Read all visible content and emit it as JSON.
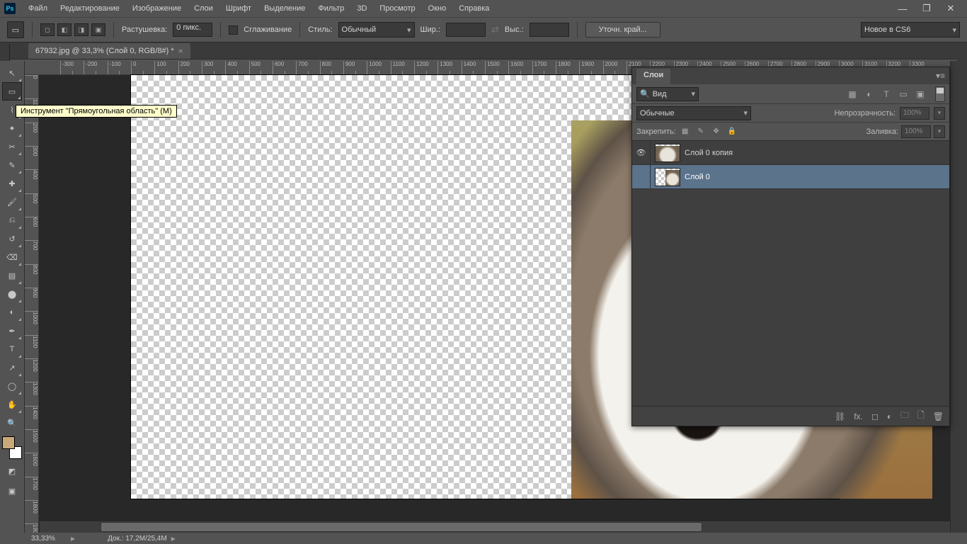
{
  "menu": [
    "Файл",
    "Редактирование",
    "Изображение",
    "Слои",
    "Шрифт",
    "Выделение",
    "Фильтр",
    "3D",
    "Просмотр",
    "Окно",
    "Справка"
  ],
  "options": {
    "feather_label": "Растушевка:",
    "feather_value": "0 пикс.",
    "antialias_label": "Сглаживание",
    "style_label": "Стиль:",
    "style_value": "Обычный",
    "width_label": "Шир.:",
    "width_value": "",
    "height_label": "Выс.:",
    "height_value": "",
    "refine_btn": "Уточн. край...",
    "whats_new": "Новое в CS6"
  },
  "doc_tab": "67932.jpg @ 33,3% (Слой 0, RGB/8#) *",
  "tooltip": "Инструмент \"Прямоугольная область\" (M)",
  "tools": [
    {
      "id": "move-tool",
      "glyph": "↖",
      "tri": true
    },
    {
      "id": "marquee-tool",
      "glyph": "▭",
      "tri": true,
      "selected": true
    },
    {
      "id": "lasso-tool",
      "glyph": "⌇",
      "tri": true
    },
    {
      "id": "magic-wand-tool",
      "glyph": "✦",
      "tri": true
    },
    {
      "id": "crop-tool",
      "glyph": "✂",
      "tri": true
    },
    {
      "id": "eyedropper-tool",
      "glyph": "✎",
      "tri": true
    },
    {
      "id": "healing-brush-tool",
      "glyph": "✚",
      "tri": true
    },
    {
      "id": "brush-tool",
      "glyph": "🖌",
      "tri": true
    },
    {
      "id": "clone-stamp-tool",
      "glyph": "⎌",
      "tri": true
    },
    {
      "id": "history-brush-tool",
      "glyph": "↺",
      "tri": true
    },
    {
      "id": "eraser-tool",
      "glyph": "⌫",
      "tri": true
    },
    {
      "id": "gradient-tool",
      "glyph": "▤",
      "tri": true
    },
    {
      "id": "blur-tool",
      "glyph": "⬤",
      "tri": true
    },
    {
      "id": "dodge-tool",
      "glyph": "◐",
      "tri": true
    },
    {
      "id": "pen-tool",
      "glyph": "✒",
      "tri": true
    },
    {
      "id": "type-tool",
      "glyph": "T",
      "tri": true
    },
    {
      "id": "path-select-tool",
      "glyph": "↗",
      "tri": true
    },
    {
      "id": "shape-tool",
      "glyph": "◯",
      "tri": true
    },
    {
      "id": "hand-tool",
      "glyph": "✋",
      "tri": true
    },
    {
      "id": "zoom-tool",
      "glyph": "🔍",
      "tri": false
    }
  ],
  "tool_footer": [
    {
      "id": "quick-mask-tool",
      "glyph": "◩"
    },
    {
      "id": "screen-mode-tool",
      "glyph": "▣"
    }
  ],
  "status": {
    "zoom": "33,33%",
    "doc": "Док.:  17,2M/25,4M"
  },
  "layers": {
    "tab": "Слои",
    "filter_label": "Вид",
    "blend_mode": "Обычные",
    "opacity_label": "Непрозрачность:",
    "opacity_value": "100%",
    "lock_label": "Закрепить:",
    "fill_label": "Заливка:",
    "fill_value": "100%",
    "rows": [
      {
        "name": "Слой 0 копия",
        "visible": true,
        "thumb": "full"
      },
      {
        "name": "Слой 0",
        "visible": false,
        "thumb": "half",
        "selected": true
      }
    ],
    "footer_icons": [
      "link-icon",
      "fx-icon",
      "mask-icon",
      "adjustment-icon",
      "group-icon",
      "new-layer-icon",
      "trash-icon"
    ],
    "footer_glyphs": [
      "⛓",
      "fx.",
      "◻",
      "◐",
      "🗀",
      "🗋",
      "🗑"
    ]
  },
  "h_ruler_start": -300,
  "h_ruler_end": 3300,
  "h_ruler_step": 50,
  "h_ruler_major": 100,
  "v_ruler_start": 0,
  "v_ruler_end": 2000,
  "v_ruler_step": 100,
  "colors": {
    "foreground": "#c9a97a",
    "background": "#ffffff"
  }
}
